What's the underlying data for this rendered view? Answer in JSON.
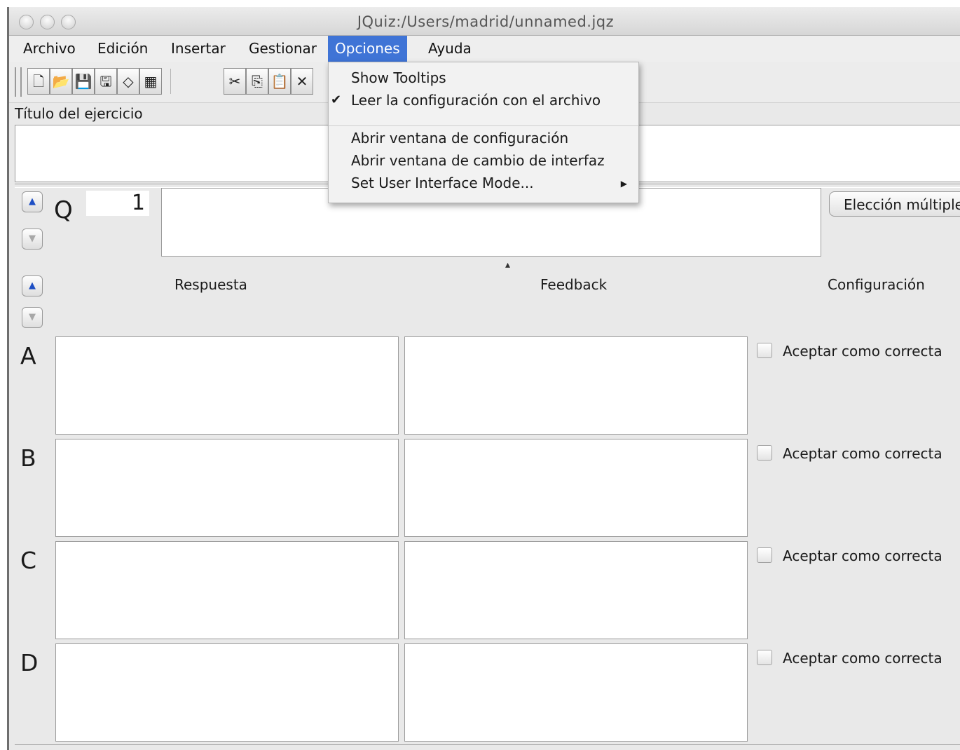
{
  "window": {
    "title": "JQuiz:/Users/madrid/unnamed.jqz"
  },
  "menubar": {
    "items": [
      {
        "label": "Archivo"
      },
      {
        "label": "Edición"
      },
      {
        "label": "Insertar"
      },
      {
        "label": "Gestionar"
      },
      {
        "label": "Opciones"
      },
      {
        "label": "Ayuda"
      }
    ],
    "active": "Opciones"
  },
  "toolbar": {
    "icons": [
      "new-file-icon",
      "open-folder-icon",
      "save-icon",
      "save-as-icon",
      "eraser-icon",
      "web-export-icon",
      "cut-icon",
      "copy-icon",
      "paste-icon",
      "delete-icon"
    ],
    "glyphs": [
      "🗋",
      "📂",
      "💾",
      "🖫",
      "◇",
      "▦",
      "✂",
      "⎘",
      "📋",
      "✕"
    ]
  },
  "exercise": {
    "title_label": "Título del ejercicio",
    "title_value": ""
  },
  "question": {
    "letter": "Q",
    "number": "1",
    "text": "",
    "type_button": "Elección múltiple"
  },
  "columns": {
    "answer": "Respuesta",
    "feedback": "Feedback",
    "config": "Configuración"
  },
  "answers": [
    {
      "letter": "A",
      "answer": "",
      "feedback": "",
      "accept_label": "Aceptar como correcta",
      "checked": false
    },
    {
      "letter": "B",
      "answer": "",
      "feedback": "",
      "accept_label": "Aceptar como correcta",
      "checked": false
    },
    {
      "letter": "C",
      "answer": "",
      "feedback": "",
      "accept_label": "Aceptar como correcta",
      "checked": false
    },
    {
      "letter": "D",
      "answer": "",
      "feedback": "",
      "accept_label": "Aceptar como correcta",
      "checked": false
    }
  ],
  "options_menu": {
    "items": [
      {
        "label": "Show Tooltips",
        "checked": false
      },
      {
        "label": "Leer la configuración con el archivo",
        "checked": true
      },
      {
        "label": "Abrir ventana de configuración"
      },
      {
        "label": "Abrir ventana de cambio de interfaz"
      },
      {
        "label": "Set User Interface Mode...",
        "submenu": true
      }
    ],
    "check_glyph": "✔",
    "submenu_glyph": "▶"
  },
  "colors": {
    "menu_highlight": "#3f74d6",
    "window_bg": "#e9e9e9",
    "arrow_up": "#1e4fc4"
  }
}
